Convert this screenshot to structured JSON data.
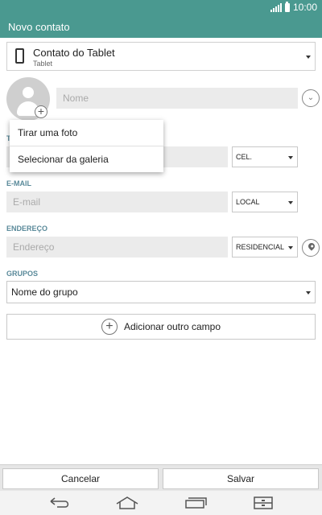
{
  "status": {
    "time": "10:00"
  },
  "appbar": {
    "title": "Novo contato"
  },
  "account": {
    "name": "Contato do Tablet",
    "type": "Tablet"
  },
  "name_field": {
    "placeholder": "Nome"
  },
  "phone": {
    "type": "CEL."
  },
  "email": {
    "label": "E-MAIL",
    "placeholder": "E-mail",
    "type": "LOCAL"
  },
  "address": {
    "label": "ENDEREÇO",
    "placeholder": "Endereço",
    "type": "RESIDENCIAL"
  },
  "groups": {
    "label": "GRUPOS",
    "value": "Nome do grupo"
  },
  "add_field": {
    "label": "Adicionar outro campo"
  },
  "photo_menu": {
    "items": [
      "Tirar uma foto",
      "Selecionar da galeria"
    ]
  },
  "actions": {
    "cancel": "Cancelar",
    "save": "Salvar"
  },
  "theme": {
    "accent": "#4a9990",
    "section_label": "#5a8a9a"
  },
  "icons": [
    "signal-icon",
    "battery-icon",
    "tablet-icon",
    "avatar-placeholder-icon",
    "add-photo-icon",
    "expand-icon",
    "location-pin-icon",
    "add-icon",
    "back-icon",
    "home-icon",
    "recent-apps-icon",
    "menu-icon"
  ]
}
